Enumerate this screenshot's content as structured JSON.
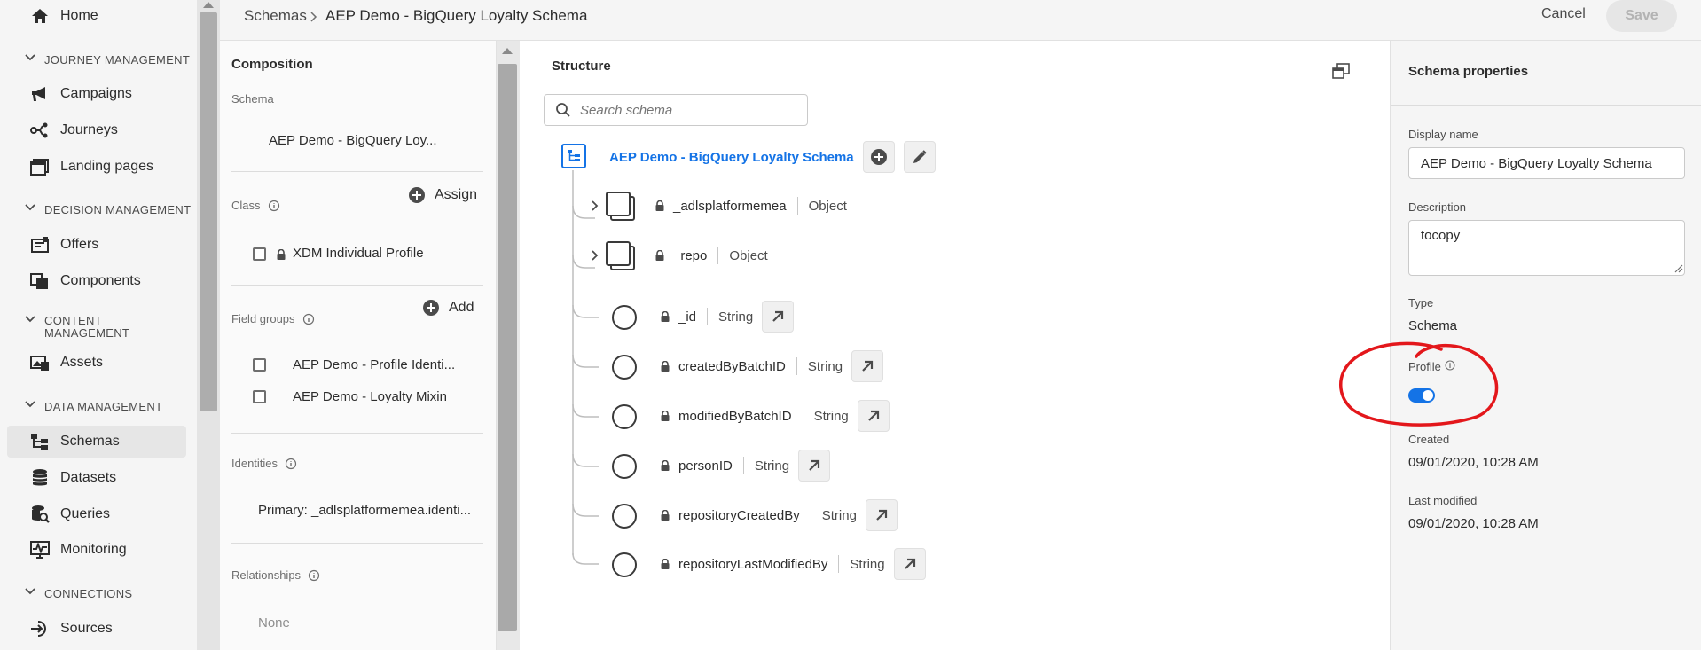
{
  "nav": {
    "items": [
      {
        "label": "Home",
        "icon": "home-icon"
      },
      {
        "label": "Campaigns",
        "icon": "megaphone-icon"
      },
      {
        "label": "Journeys",
        "icon": "journey-icon"
      },
      {
        "label": "Landing pages",
        "icon": "landing-page-icon"
      },
      {
        "label": "Offers",
        "icon": "offers-icon"
      },
      {
        "label": "Components",
        "icon": "components-icon"
      },
      {
        "label": "Assets",
        "icon": "assets-icon"
      },
      {
        "label": "Schemas",
        "icon": "schema-icon",
        "selected": true
      },
      {
        "label": "Datasets",
        "icon": "database-icon"
      },
      {
        "label": "Queries",
        "icon": "queries-icon"
      },
      {
        "label": "Monitoring",
        "icon": "monitoring-icon"
      },
      {
        "label": "Sources",
        "icon": "sources-icon"
      }
    ],
    "sections": {
      "journey": "JOURNEY MANAGEMENT",
      "decision": "DECISION MANAGEMENT",
      "content_line1": "CONTENT",
      "content_line2": "MANAGEMENT",
      "data": "DATA MANAGEMENT",
      "connections": "CONNECTIONS"
    }
  },
  "header": {
    "breadcrumb_parent": "Schemas",
    "breadcrumb_current": "AEP Demo - BigQuery Loyalty Schema",
    "cancel_label": "Cancel",
    "save_label": "Save"
  },
  "composition": {
    "title": "Composition",
    "schema_label": "Schema",
    "schema_name": "AEP Demo - BigQuery Loy...",
    "class_label": "Class",
    "assign_label": "Assign",
    "class_name": "XDM Individual Profile",
    "field_groups_label": "Field groups",
    "add_label": "Add",
    "field_groups": [
      "AEP Demo - Profile Identi...",
      "AEP Demo - Loyalty Mixin"
    ],
    "identities_label": "Identities",
    "identity_primary": "Primary: _adlsplatformemea.identi...",
    "relationships_label": "Relationships",
    "relationships_value": "None"
  },
  "structure": {
    "title": "Structure",
    "search_placeholder": "Search schema",
    "root": "AEP Demo - BigQuery Loyalty Schema",
    "fields": [
      {
        "name": "_adlsplatformemea",
        "type": "Object"
      },
      {
        "name": "_repo",
        "type": "Object"
      },
      {
        "name": "_id",
        "type": "String"
      },
      {
        "name": "createdByBatchID",
        "type": "String"
      },
      {
        "name": "modifiedByBatchID",
        "type": "String"
      },
      {
        "name": "personID",
        "type": "String"
      },
      {
        "name": "repositoryCreatedBy",
        "type": "String"
      },
      {
        "name": "repositoryLastModifiedBy",
        "type": "String"
      }
    ]
  },
  "properties": {
    "title": "Schema properties",
    "display_name_label": "Display name",
    "display_name_value": "AEP Demo - BigQuery Loyalty Schema",
    "description_label": "Description",
    "description_value": "tocopy",
    "type_label": "Type",
    "type_value": "Schema",
    "profile_label": "Profile",
    "profile_enabled": true,
    "created_label": "Created",
    "created_value": "09/01/2020, 10:28 AM",
    "last_modified_label": "Last modified",
    "last_modified_value": "09/01/2020, 10:28 AM"
  },
  "colors": {
    "accent": "#1473e6",
    "annotation": "#e3171b",
    "nav_bg": "#f5f5f5"
  }
}
